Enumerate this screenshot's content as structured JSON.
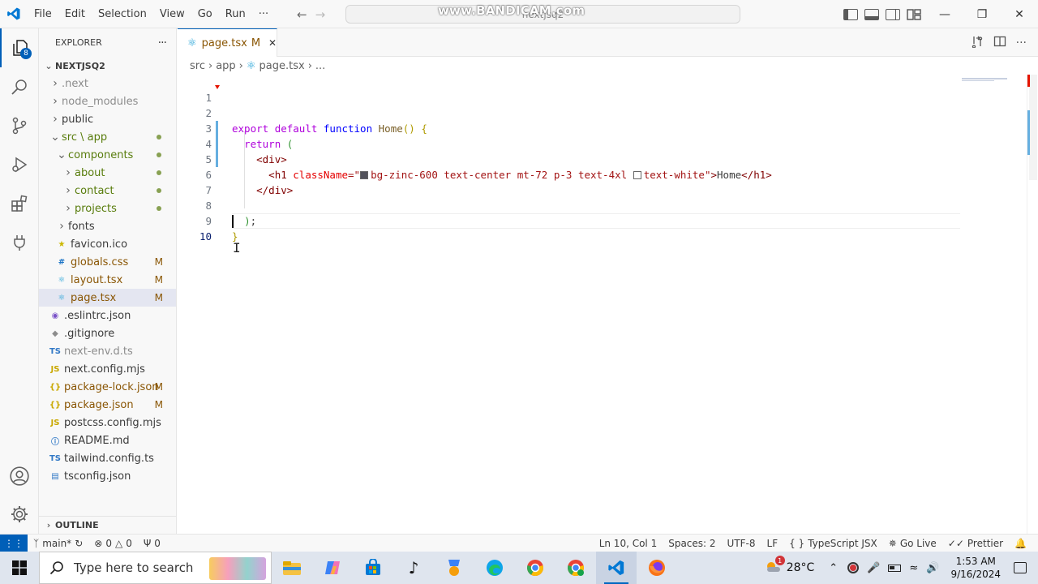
{
  "titlebar": {
    "menu": [
      "File",
      "Edit",
      "Selection",
      "View",
      "Go",
      "Run",
      "···"
    ],
    "command_center": "nextjsq2",
    "watermark": "www.BANDICAM.com"
  },
  "activitybar": {
    "explorer_badge": "8"
  },
  "sidebar": {
    "title": "EXPLORER",
    "more": "···",
    "project": "NEXTJSQ2",
    "items": [
      {
        "label": ".next",
        "type": "folder",
        "depth": 1,
        "color": "#8c8c8c"
      },
      {
        "label": "node_modules",
        "type": "folder",
        "depth": 1,
        "color": "#8c8c8c"
      },
      {
        "label": "public",
        "type": "folder",
        "depth": 1,
        "color": "#3b3b3b"
      },
      {
        "label": "src \\ app",
        "type": "folder-open",
        "depth": 1,
        "color": "#587c0c",
        "dot": true
      },
      {
        "label": "components",
        "type": "folder-open",
        "depth": 2,
        "color": "#587c0c",
        "dot": true
      },
      {
        "label": "about",
        "type": "folder",
        "depth": 3,
        "color": "#587c0c",
        "dot": true
      },
      {
        "label": "contact",
        "type": "folder",
        "depth": 3,
        "color": "#587c0c",
        "dot": true
      },
      {
        "label": "projects",
        "type": "folder",
        "depth": 3,
        "color": "#587c0c",
        "dot": true
      },
      {
        "label": "fonts",
        "type": "folder",
        "depth": 2,
        "color": "#3b3b3b"
      },
      {
        "label": "favicon.ico",
        "type": "file",
        "depth": 2,
        "icon": "★",
        "icon_color": "#cbb700",
        "color": "#3b3b3b"
      },
      {
        "label": "globals.css",
        "type": "file",
        "depth": 2,
        "icon": "#",
        "icon_color": "#1a73c6",
        "color": "#895503",
        "status": "M"
      },
      {
        "label": "layout.tsx",
        "type": "file",
        "depth": 2,
        "icon": "⚛",
        "icon_color": "#1a9fd6",
        "color": "#895503",
        "status": "M"
      },
      {
        "label": "page.tsx",
        "type": "file",
        "depth": 2,
        "icon": "⚛",
        "icon_color": "#1a9fd6",
        "color": "#895503",
        "status": "M",
        "selected": true
      },
      {
        "label": ".eslintrc.json",
        "type": "file",
        "depth": 1,
        "icon": "◉",
        "icon_color": "#7a52c8",
        "color": "#3b3b3b"
      },
      {
        "label": ".gitignore",
        "type": "file",
        "depth": 1,
        "icon": "◆",
        "icon_color": "#8c8c8c",
        "color": "#3b3b3b"
      },
      {
        "label": "next-env.d.ts",
        "type": "file",
        "depth": 1,
        "icon": "TS",
        "icon_color": "#3178c6",
        "color": "#8c8c8c"
      },
      {
        "label": "next.config.mjs",
        "type": "file",
        "depth": 1,
        "icon": "JS",
        "icon_color": "#c9a800",
        "color": "#3b3b3b"
      },
      {
        "label": "package-lock.json",
        "type": "file",
        "depth": 1,
        "icon": "{}",
        "icon_color": "#c9a800",
        "color": "#895503",
        "status": "M"
      },
      {
        "label": "package.json",
        "type": "file",
        "depth": 1,
        "icon": "{}",
        "icon_color": "#c9a800",
        "color": "#895503",
        "status": "M"
      },
      {
        "label": "postcss.config.mjs",
        "type": "file",
        "depth": 1,
        "icon": "JS",
        "icon_color": "#c9a800",
        "color": "#3b3b3b"
      },
      {
        "label": "README.md",
        "type": "file",
        "depth": 1,
        "icon": "ⓘ",
        "icon_color": "#3178c6",
        "color": "#3b3b3b"
      },
      {
        "label": "tailwind.config.ts",
        "type": "file",
        "depth": 1,
        "icon": "TS",
        "icon_color": "#3178c6",
        "color": "#3b3b3b"
      },
      {
        "label": "tsconfig.json",
        "type": "file",
        "depth": 1,
        "icon": "▤",
        "icon_color": "#3178c6",
        "color": "#3b3b3b"
      }
    ],
    "outline": "OUTLINE"
  },
  "tab": {
    "label": "page.tsx",
    "status": "M",
    "close": "✕"
  },
  "breadcrumb": [
    "src",
    "app",
    "page.tsx",
    "..."
  ],
  "code": {
    "line_numbers": [
      "1",
      "2",
      "3",
      "4",
      "5",
      "6",
      "7",
      "8",
      "9",
      "10"
    ],
    "l2": {
      "export": "export",
      "default": "default",
      "function": "function",
      "name": "Home",
      "parens": "()",
      "brace": "{"
    },
    "l3": {
      "return": "return",
      "paren": "("
    },
    "l4": {
      "open": "<",
      "tag": "div",
      "close": ">"
    },
    "l5": {
      "open": "<",
      "tag": "h1",
      "attr": "className",
      "eq": "=\"",
      "classes_a": "bg-zinc-600 text-center mt-72 p-3 text-4xl",
      "classes_b": "text-white",
      "q": "\"",
      "gt": ">",
      "text": "Home",
      "end_open": "</",
      "end_tag": "h1",
      "end_close": ">"
    },
    "l6": {
      "open": "</",
      "tag": "div",
      "close": ">"
    },
    "l8": {
      "paren": ")",
      "semi": ";"
    },
    "l9": {
      "brace": "}"
    },
    "swatch_colors": [
      "#52525b",
      "#ffffff"
    ]
  },
  "statusbar": {
    "branch": "main*",
    "errors": "0",
    "warnings": "0",
    "ports": "0",
    "position": "Ln 10, Col 1",
    "spaces": "Spaces: 2",
    "encoding": "UTF-8",
    "eol": "LF",
    "language": "TypeScript JSX",
    "golive": "Go Live",
    "prettier": "Prettier"
  },
  "taskbar": {
    "search_placeholder": "Type here to search",
    "temperature": "28°C",
    "weather_badge": "1",
    "time": "1:53 AM",
    "date": "9/16/2024"
  },
  "colors": {
    "accent": "#005fb8",
    "modified": "#895503",
    "untracked_green": "#587c0c"
  }
}
